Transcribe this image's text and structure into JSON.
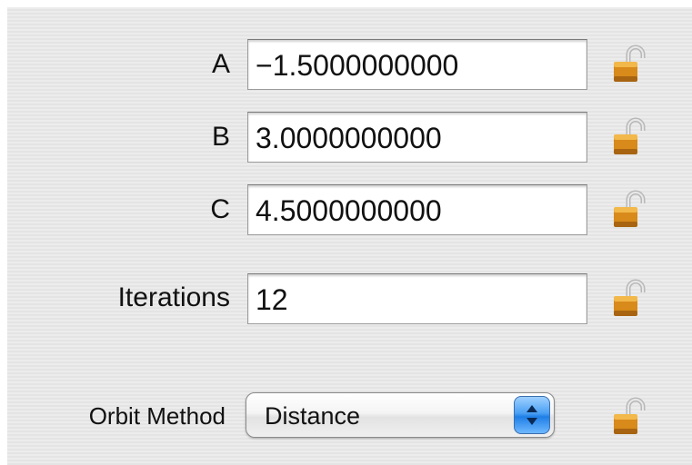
{
  "fields": [
    {
      "label": "A",
      "value": "−1.5000000000"
    },
    {
      "label": "B",
      "value": "3.0000000000"
    },
    {
      "label": "C",
      "value": "4.5000000000"
    },
    {
      "label": "Iterations",
      "value": "12"
    }
  ],
  "orbit_method": {
    "label": "Orbit Method",
    "selected": "Distance"
  },
  "icons": {
    "lock": "unlocked-padlock-icon",
    "popup_arrows": "up-down-arrows-icon"
  },
  "colors": {
    "panel_bg": "#e9e9e9",
    "lock_gold": "#d88a1a",
    "popup_accent": "#2f86ea"
  }
}
